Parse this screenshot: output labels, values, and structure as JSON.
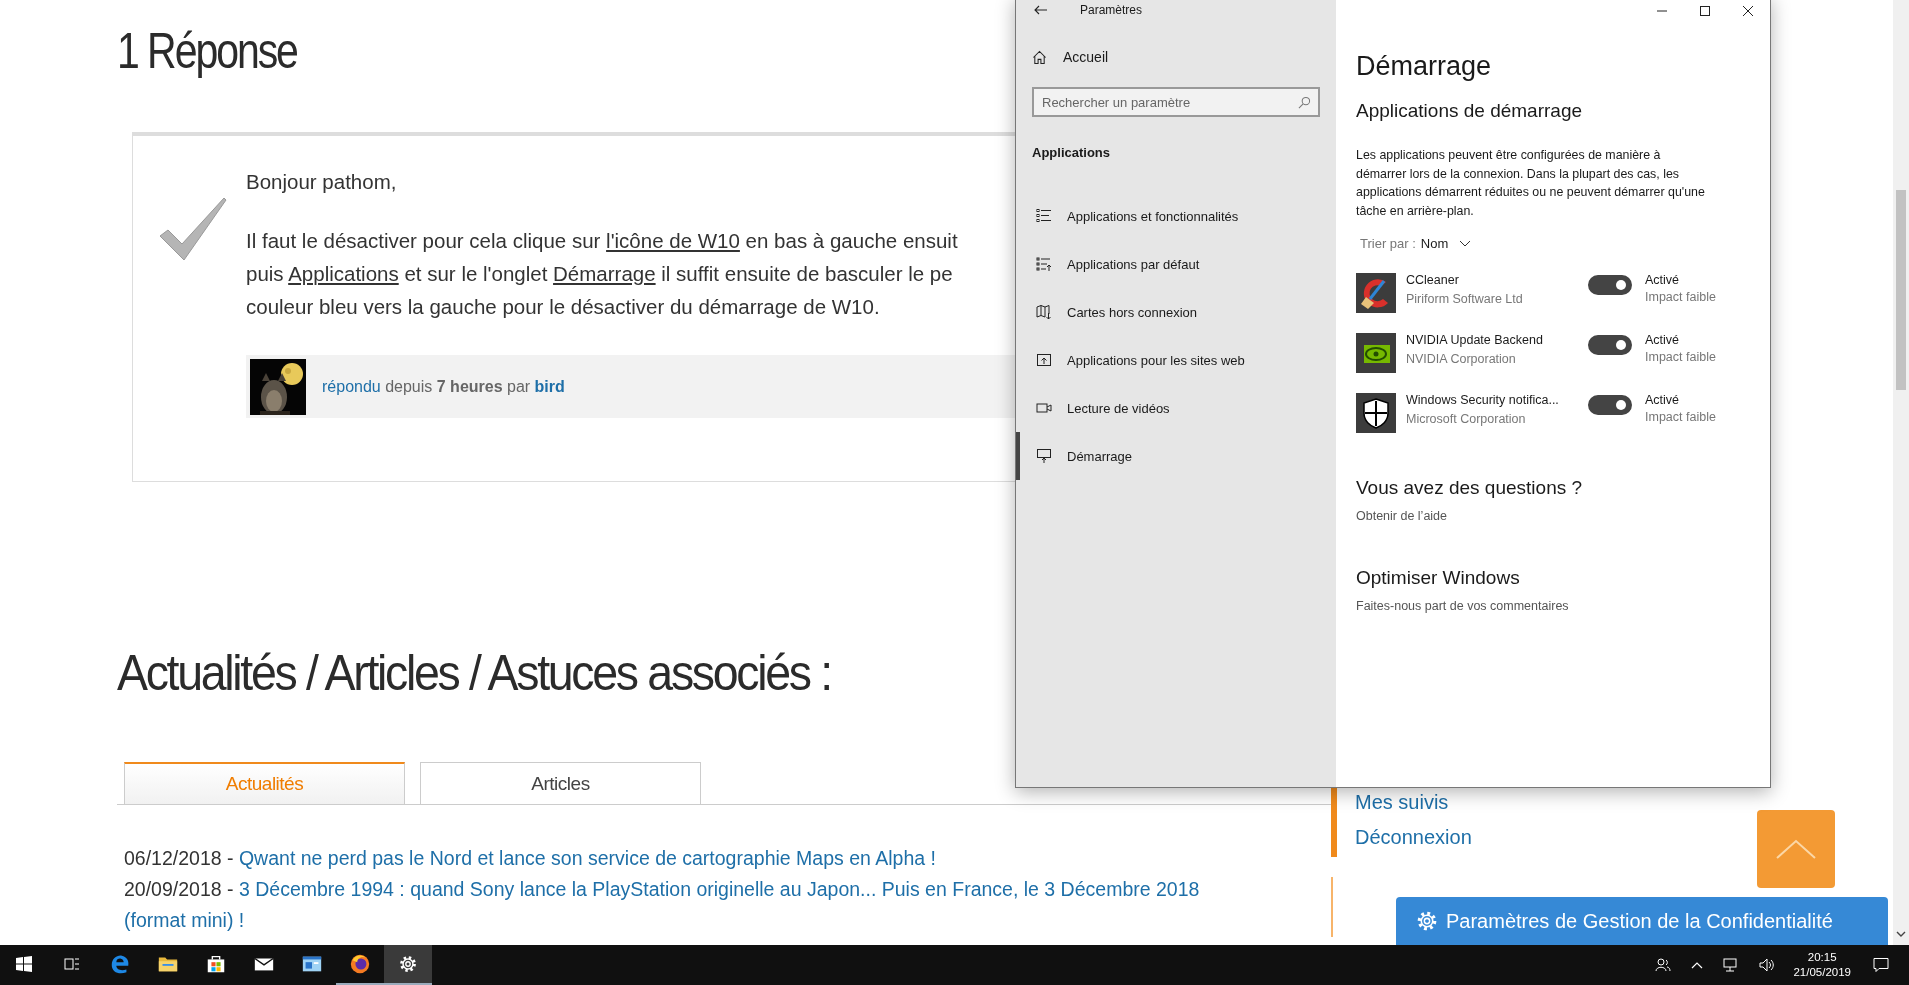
{
  "webpage": {
    "answers_heading": "1 Réponse",
    "answer": {
      "greeting": "Bonjour pathom,",
      "lines": [
        [
          {
            "text": "Il faut le désactiver pour cela clique sur ",
            "link": false
          },
          {
            "text": "l'icône de W10",
            "link": true
          },
          {
            "text": " en bas à gauche ensuit",
            "link": false
          }
        ],
        [
          {
            "text": "puis ",
            "link": false
          },
          {
            "text": "Applications",
            "link": true
          },
          {
            "text": " et sur le l'onglet ",
            "link": false
          },
          {
            "text": "Démarrage",
            "link": true
          },
          {
            "text": " il suffit ensuite de basculer le pe",
            "link": false
          }
        ],
        [
          {
            "text": "couleur bleu vers la gauche pour le désactiver du démarrage de W10.",
            "link": false
          }
        ]
      ],
      "meta": [
        {
          "text": "répondu",
          "kind": "link"
        },
        {
          "text": " depuis ",
          "kind": "plain"
        },
        {
          "text": "7 heures",
          "kind": "strong"
        },
        {
          "text": " par ",
          "kind": "plain"
        },
        {
          "text": "bird",
          "kind": "author"
        }
      ]
    },
    "related_heading": "Actualités / Articles / Astuces associés :",
    "tabs": [
      {
        "label": "Actualités",
        "selected": true
      },
      {
        "label": "Articles",
        "selected": false
      }
    ],
    "news": [
      {
        "date": "06/12/2018 - ",
        "title_lines": [
          "Qwant ne perd pas le Nord et lance son service de cartographie Maps en Alpha !"
        ]
      },
      {
        "date": "20/09/2018 - ",
        "title_lines": [
          "3 Décembre 1994 : quand Sony lance la PlayStation originelle au Japon... Puis en France, le 3 Décembre 2018",
          "(format mini) !"
        ]
      }
    ],
    "user_links": [
      "Mes suivis",
      "Déconnexion"
    ],
    "privacy_button": "Paramètres de Gestion de la Confidentialité"
  },
  "settings_window": {
    "title": "Paramètres",
    "home": "Accueil",
    "search_placeholder": "Rechercher un paramètre",
    "section": "Applications",
    "nav": [
      {
        "label": "Applications et fonctionnalités",
        "selected": false
      },
      {
        "label": "Applications par défaut",
        "selected": false
      },
      {
        "label": "Cartes hors connexion",
        "selected": false
      },
      {
        "label": "Applications pour les sites web",
        "selected": false
      },
      {
        "label": "Lecture de vidéos",
        "selected": false
      },
      {
        "label": "Démarrage",
        "selected": true
      }
    ],
    "page_title": "Démarrage",
    "heading": "Applications de démarrage",
    "description": "Les applications peuvent être configurées de manière à démarrer lors de la connexion. Dans la plupart des cas, les applications démarrent réduites ou ne peuvent démarrer qu'une tâche en arrière-plan.",
    "sort_label": "Trier par :",
    "sort_value": "Nom",
    "apps": [
      {
        "name": "CCleaner",
        "publisher": "Piriform Software Ltd",
        "on": true,
        "status": "Activé",
        "impact": "Impact faible"
      },
      {
        "name": "NVIDIA Update Backend",
        "publisher": "NVIDIA Corporation",
        "on": true,
        "status": "Activé",
        "impact": "Impact faible"
      },
      {
        "name": "Windows Security notifica...",
        "publisher": "Microsoft Corporation",
        "on": true,
        "status": "Activé",
        "impact": "Impact faible"
      }
    ],
    "help_heading": "Vous avez des questions ?",
    "help_link": "Obtenir de l’aide",
    "feedback_heading": "Optimiser Windows",
    "feedback_link": "Faites-nous part de vos commentaires"
  },
  "taskbar": {
    "apps": [
      {
        "selected": false,
        "running": false
      },
      {
        "selected": false,
        "running": false
      },
      {
        "selected": false,
        "running": false
      },
      {
        "selected": false,
        "running": false
      },
      {
        "selected": false,
        "running": false
      },
      {
        "selected": false,
        "running": true
      },
      {
        "selected": true,
        "running": true
      }
    ],
    "clock": {
      "time": "20:15",
      "date": "21/05/2019"
    }
  }
}
